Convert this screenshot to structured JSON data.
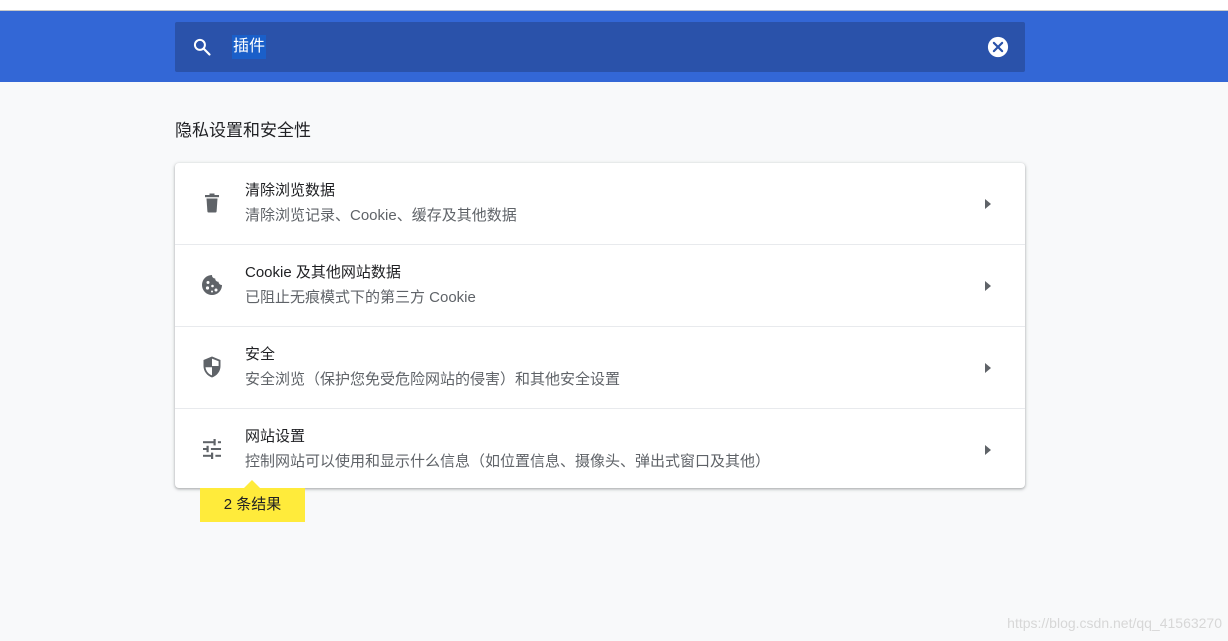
{
  "search": {
    "query": "插件"
  },
  "section": {
    "title": "隐私设置和安全性"
  },
  "items": [
    {
      "title": "清除浏览数据",
      "subtitle": "清除浏览记录、Cookie、缓存及其他数据",
      "icon": "trash-icon"
    },
    {
      "title": "Cookie 及其他网站数据",
      "subtitle": "已阻止无痕模式下的第三方 Cookie",
      "icon": "cookie-icon"
    },
    {
      "title": "安全",
      "subtitle": "安全浏览（保护您免受危险网站的侵害）和其他安全设置",
      "icon": "shield-icon"
    },
    {
      "title": "网站设置",
      "subtitle": "控制网站可以使用和显示什么信息（如位置信息、摄像头、弹出式窗口及其他）",
      "icon": "tune-icon"
    }
  ],
  "results_badge": "2 条结果",
  "watermark": "https://blog.csdn.net/qq_41563270",
  "colors": {
    "header": "#3367d6",
    "search_box": "#2a52aa",
    "badge": "#ffeb3b",
    "background": "#f8f9fa"
  }
}
